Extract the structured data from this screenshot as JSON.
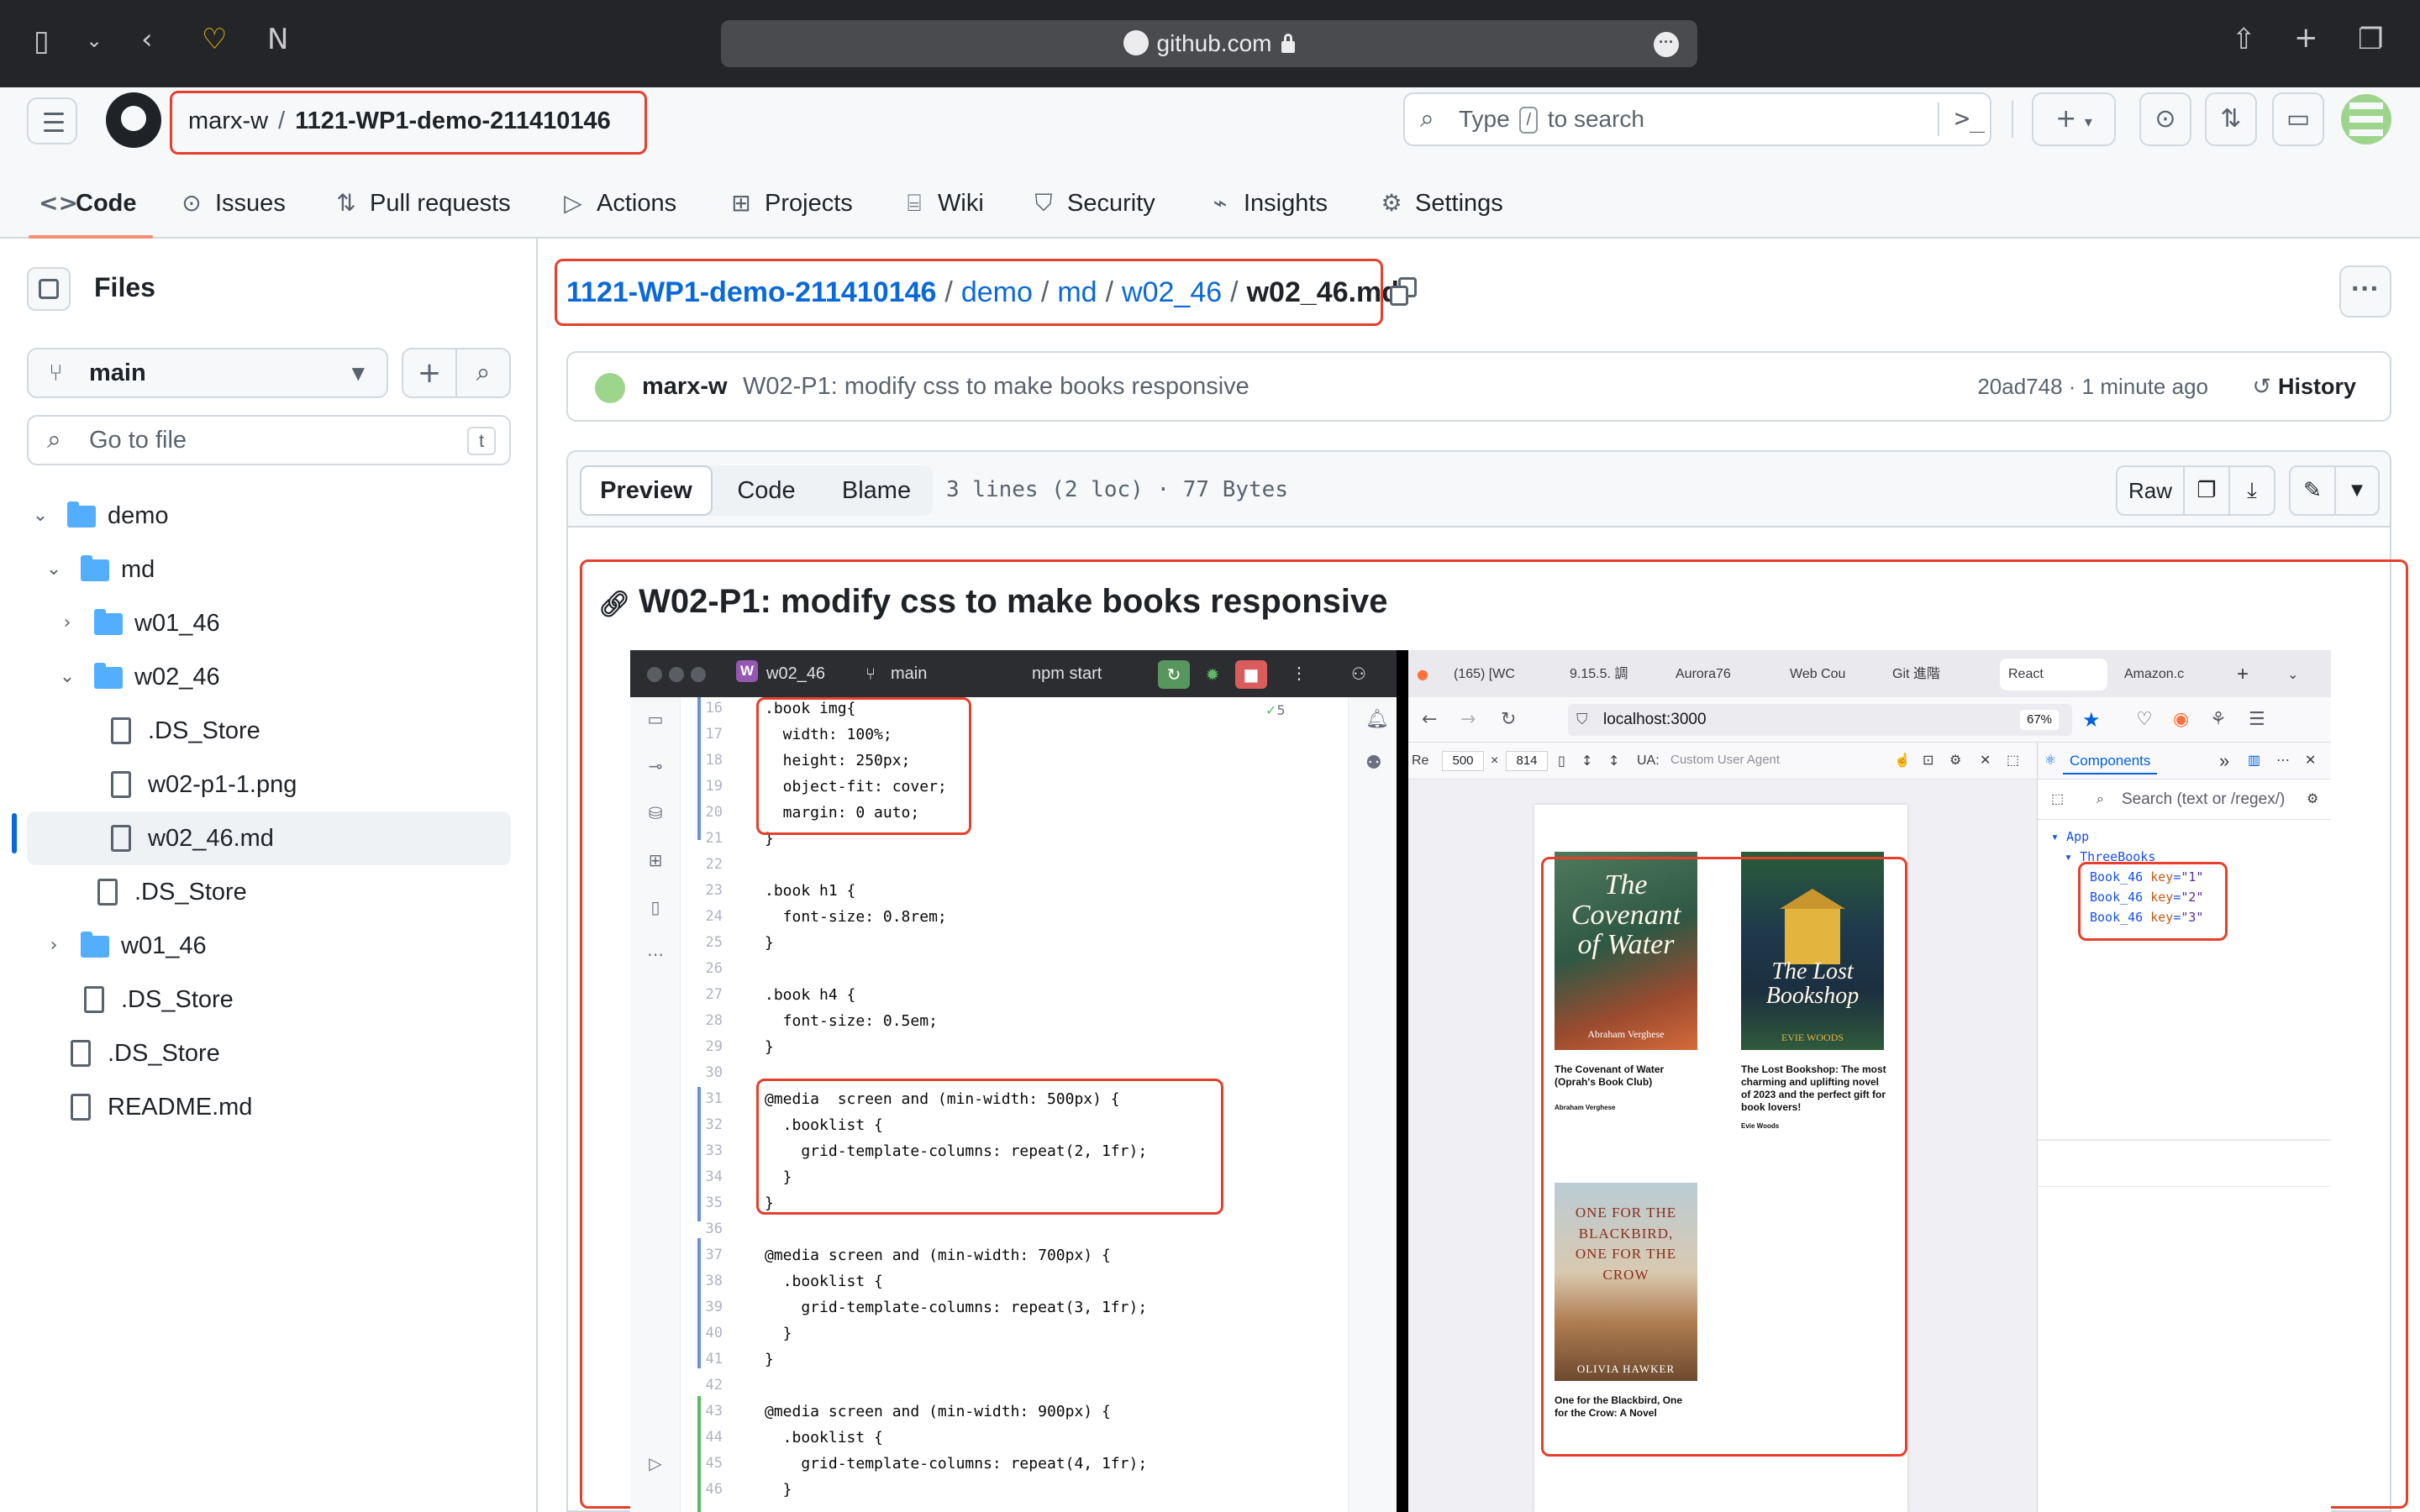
{
  "browser": {
    "url": "github.com"
  },
  "header": {
    "owner": "marx-w",
    "separator": "/",
    "repo": "1121-WP1-demo-211410146",
    "search_prefix": "Type",
    "search_key": "/",
    "search_suffix": "to search"
  },
  "repo_nav": {
    "tabs": [
      {
        "label": "Code",
        "icon": "code-icon"
      },
      {
        "label": "Issues",
        "icon": "issue-icon"
      },
      {
        "label": "Pull requests",
        "icon": "pull-request-icon"
      },
      {
        "label": "Actions",
        "icon": "play-icon"
      },
      {
        "label": "Projects",
        "icon": "table-icon"
      },
      {
        "label": "Wiki",
        "icon": "book-icon"
      },
      {
        "label": "Security",
        "icon": "shield-icon"
      },
      {
        "label": "Insights",
        "icon": "graph-icon"
      },
      {
        "label": "Settings",
        "icon": "gear-icon"
      }
    ]
  },
  "sidebar": {
    "title": "Files",
    "branch": "main",
    "goto_placeholder": "Go to file",
    "goto_key": "t",
    "tree": [
      {
        "label": "demo",
        "type": "folder",
        "expanded": true
      },
      {
        "label": "md",
        "type": "folder",
        "expanded": true
      },
      {
        "label": "w01_46",
        "type": "folder",
        "expanded": false
      },
      {
        "label": "w02_46",
        "type": "folder",
        "expanded": true
      },
      {
        "label": ".DS_Store",
        "type": "file"
      },
      {
        "label": "w02-p1-1.png",
        "type": "file"
      },
      {
        "label": "w02_46.md",
        "type": "file",
        "selected": true
      },
      {
        "label": ".DS_Store",
        "type": "file"
      },
      {
        "label": "w01_46",
        "type": "folder",
        "expanded": false
      },
      {
        "label": ".DS_Store",
        "type": "file"
      },
      {
        "label": ".DS_Store",
        "type": "file"
      },
      {
        "label": "README.md",
        "type": "file"
      }
    ]
  },
  "breadcrumb": {
    "repo": "1121-WP1-demo-211410146",
    "parts": [
      "demo",
      "md",
      "w02_46"
    ],
    "file": "w02_46.md",
    "sep": "/"
  },
  "commit": {
    "author": "marx-w",
    "message": "W02-P1: modify css to make books responsive",
    "meta": "20ad748 · 1 minute ago",
    "history_label": "History"
  },
  "file_header": {
    "tabs": [
      "Preview",
      "Code",
      "Blame"
    ],
    "active_tab": "Preview",
    "info": "3 lines (2 loc) · 77 Bytes",
    "raw_label": "Raw"
  },
  "markdown": {
    "heading": "W02-P1: modify css to make books responsive"
  },
  "embedded": {
    "ide": {
      "project_badge": "W",
      "project": "w02_46",
      "branch": "main",
      "run_config": "npm start",
      "problems": "5",
      "line_numbers": [
        "16",
        "17",
        "18",
        "19",
        "20",
        "21",
        "22",
        "23",
        "24",
        "25",
        "26",
        "27",
        "28",
        "29",
        "30",
        "31",
        "32",
        "33",
        "34",
        "35",
        "36",
        "37",
        "38",
        "39",
        "40",
        "41",
        "42",
        "43",
        "44",
        "45",
        "46"
      ],
      "code": [
        ".book img{",
        "  width: 100%;",
        "  height: 250px;",
        "  object-fit: cover;",
        "  margin: 0 auto;",
        "}",
        "",
        ".book h1 {",
        "  font-size: 0.8rem;",
        "}",
        "",
        ".book h4 {",
        "  font-size: 0.5em;",
        "}",
        "",
        "@media  screen and (min-width: 500px) {",
        "  .booklist {",
        "    grid-template-columns: repeat(2, 1fr);",
        "  }",
        "}",
        "",
        "@media screen and (min-width: 700px) {",
        "  .booklist {",
        "    grid-template-columns: repeat(3, 1fr);",
        "  }",
        "}",
        "",
        "@media screen and (min-width: 900px) {",
        "  .booklist {",
        "    grid-template-columns: repeat(4, 1fr);",
        "  }"
      ]
    },
    "browser": {
      "tabs": [
        "(165) [WC",
        "9.15.5. 調",
        "Aurora76",
        "Web Cou",
        "Git 進階",
        "React",
        "Amazon.c"
      ],
      "url": "localhost:3000",
      "zoom": "67%",
      "rdm_label": "Re",
      "rdm_width": "500",
      "rdm_x": "×",
      "rdm_height": "814",
      "ua_label": "UA:",
      "ua_placeholder": "Custom User Agent",
      "books": [
        {
          "cover_title": "The Covenant of Water",
          "cover_author": "Abraham Verghese",
          "caption": "The Covenant of Water (Oprah's Book Club)",
          "by": "Abraham Verghese",
          "bg": "#3f6a52"
        },
        {
          "cover_title": "The Lost Bookshop",
          "cover_author": "EVIE WOODS",
          "caption": "The Lost Bookshop: The most charming and uplifting novel of 2023 and the perfect gift for book lovers!",
          "by": "Evie Woods",
          "bg": "#1e3a4c"
        },
        {
          "cover_title": "ONE FOR THE BLACKBIRD, ONE FOR THE CROW",
          "cover_author": "OLIVIA HAWKER",
          "caption": "One for the Blackbird, One for the Crow: A Novel",
          "by": "",
          "bg": "#8a6a4e"
        }
      ]
    },
    "devtools": {
      "tab": "Components",
      "search_placeholder": "Search (text or /regex/)",
      "tree": [
        {
          "name": "App"
        },
        {
          "name": "ThreeBooks"
        },
        {
          "name": "Book_46",
          "attr": "key",
          "value": "\"1\""
        },
        {
          "name": "Book_46",
          "attr": "key",
          "value": "\"2\""
        },
        {
          "name": "Book_46",
          "attr": "key",
          "value": "\"3\""
        }
      ]
    }
  },
  "colors": {
    "annotation_red": "#e5402b",
    "link_blue": "#0969da",
    "nav_underline": "#fd8c73"
  }
}
